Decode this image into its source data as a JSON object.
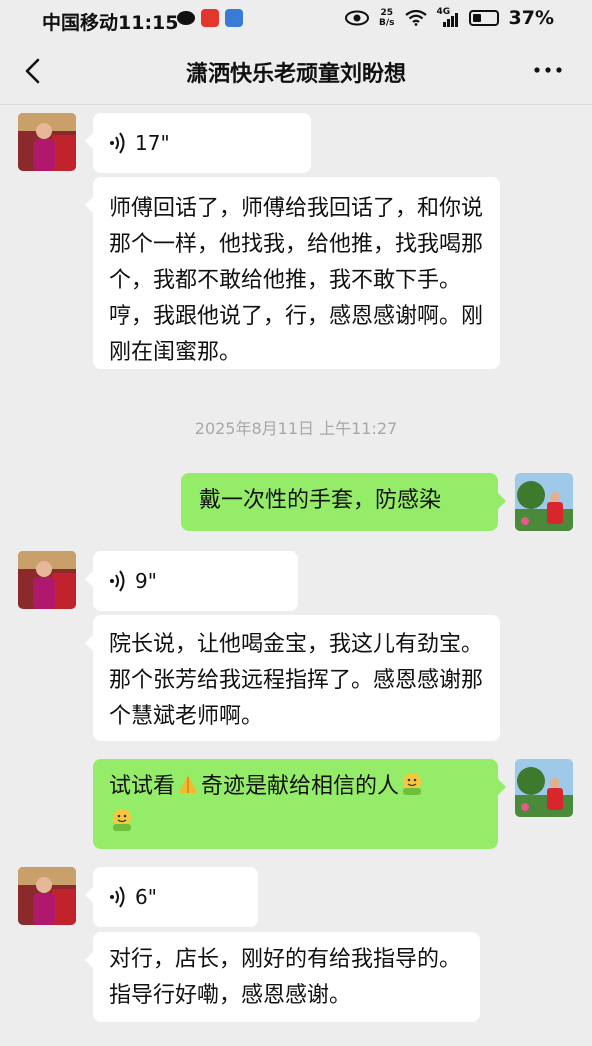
{
  "status_bar": {
    "carrier_time": "中国移动11:15",
    "net_speed_value": "25",
    "net_speed_unit": "B/s",
    "signal_label": "4G",
    "battery": "37%",
    "battery_level": 0.37
  },
  "header": {
    "title": "潇洒快乐老顽童刘盼想",
    "back_icon": "chevron-left-icon",
    "more_icon": "more-dots-icon"
  },
  "messages": [
    {
      "side": "left",
      "type": "voice",
      "duration": "17\""
    },
    {
      "side": "left",
      "type": "text",
      "text": "师傅回话了，师傅给我回话了，和你说那个一样，他找我，给他推，找我喝那个，我都不敢给他推，我不敢下手。哼，我跟他说了，行，感恩感谢啊。刚刚在闺蜜那。"
    },
    {
      "type": "timestamp",
      "text": "2025年8月11日 上午11:27"
    },
    {
      "side": "right",
      "type": "text",
      "text": "戴一次性的手套，防感染"
    },
    {
      "side": "left",
      "type": "voice",
      "duration": "9\""
    },
    {
      "side": "left",
      "type": "text",
      "text": "院长说，让他喝金宝，我这儿有劲宝。那个张芳给我远程指挥了。感恩感谢那个慧斌老师啊。"
    },
    {
      "side": "right",
      "type": "text",
      "text_part1": "试试看",
      "text_part2": "奇迹是献给相信的人",
      "emojis": [
        "pray-emoji",
        "hug-emoji",
        "hug-emoji"
      ]
    },
    {
      "side": "left",
      "type": "voice",
      "duration": "6\""
    },
    {
      "side": "left",
      "type": "text",
      "text": "对行，店长，刚好的有给我指导的。指导行好嘞，感恩感谢。"
    }
  ],
  "colors": {
    "background": "#ededed",
    "bubble_self": "#95ec69",
    "bubble_other": "#ffffff",
    "timestamp": "#a8a8a8"
  }
}
